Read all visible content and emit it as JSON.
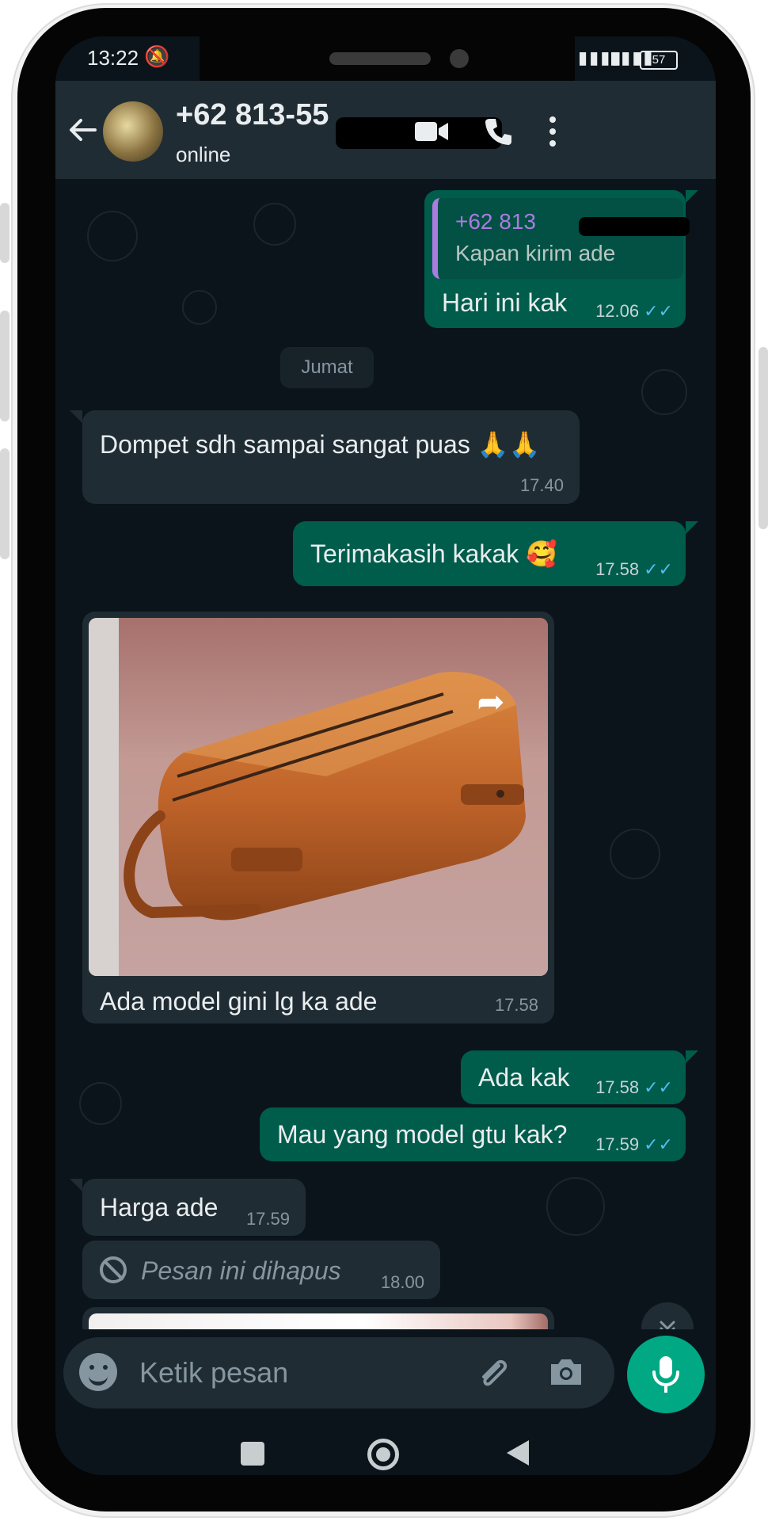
{
  "status_bar": {
    "time": "13:22",
    "battery": "57"
  },
  "header": {
    "contact_name": "+62 813-55",
    "contact_status": "online"
  },
  "messages": [
    {
      "id": "m1",
      "direction": "out",
      "quote_name": "+62 813",
      "quote_text": "Kapan kirim ade",
      "text": "Hari ini kak",
      "time": "12.06",
      "ticks": "✓✓"
    },
    {
      "id": "date",
      "date_label": "Jumat"
    },
    {
      "id": "m2",
      "direction": "in",
      "text": "Dompet sdh sampai sangat puas 🙏🙏",
      "time": "17.40"
    },
    {
      "id": "m3",
      "direction": "out",
      "text": "Terimakasih kakak 🥰",
      "time": "17.58",
      "ticks": "✓✓"
    },
    {
      "id": "m4",
      "direction": "in",
      "image": "leather toiletry bag photo",
      "text": "Ada model gini lg ka ade",
      "time": "17.58"
    },
    {
      "id": "m5",
      "direction": "out",
      "text": "Ada kak",
      "time": "17.58",
      "ticks": "✓✓"
    },
    {
      "id": "m6",
      "direction": "out",
      "text": "Mau yang model gtu kak?",
      "time": "17.59",
      "ticks": "✓✓"
    },
    {
      "id": "m7",
      "direction": "in",
      "text": "Harga ade",
      "time": "17.59"
    },
    {
      "id": "m8",
      "direction": "in",
      "deleted": true,
      "text": "Pesan ini dihapus",
      "time": "18.00"
    }
  ],
  "composer": {
    "placeholder": "Ketik pesan"
  },
  "colors": {
    "outgoing_bubble": "#005c4b",
    "incoming_bubble": "#202c33",
    "chat_background": "#0b141a",
    "accent_green": "#00a884",
    "read_ticks": "#53bdeb"
  }
}
